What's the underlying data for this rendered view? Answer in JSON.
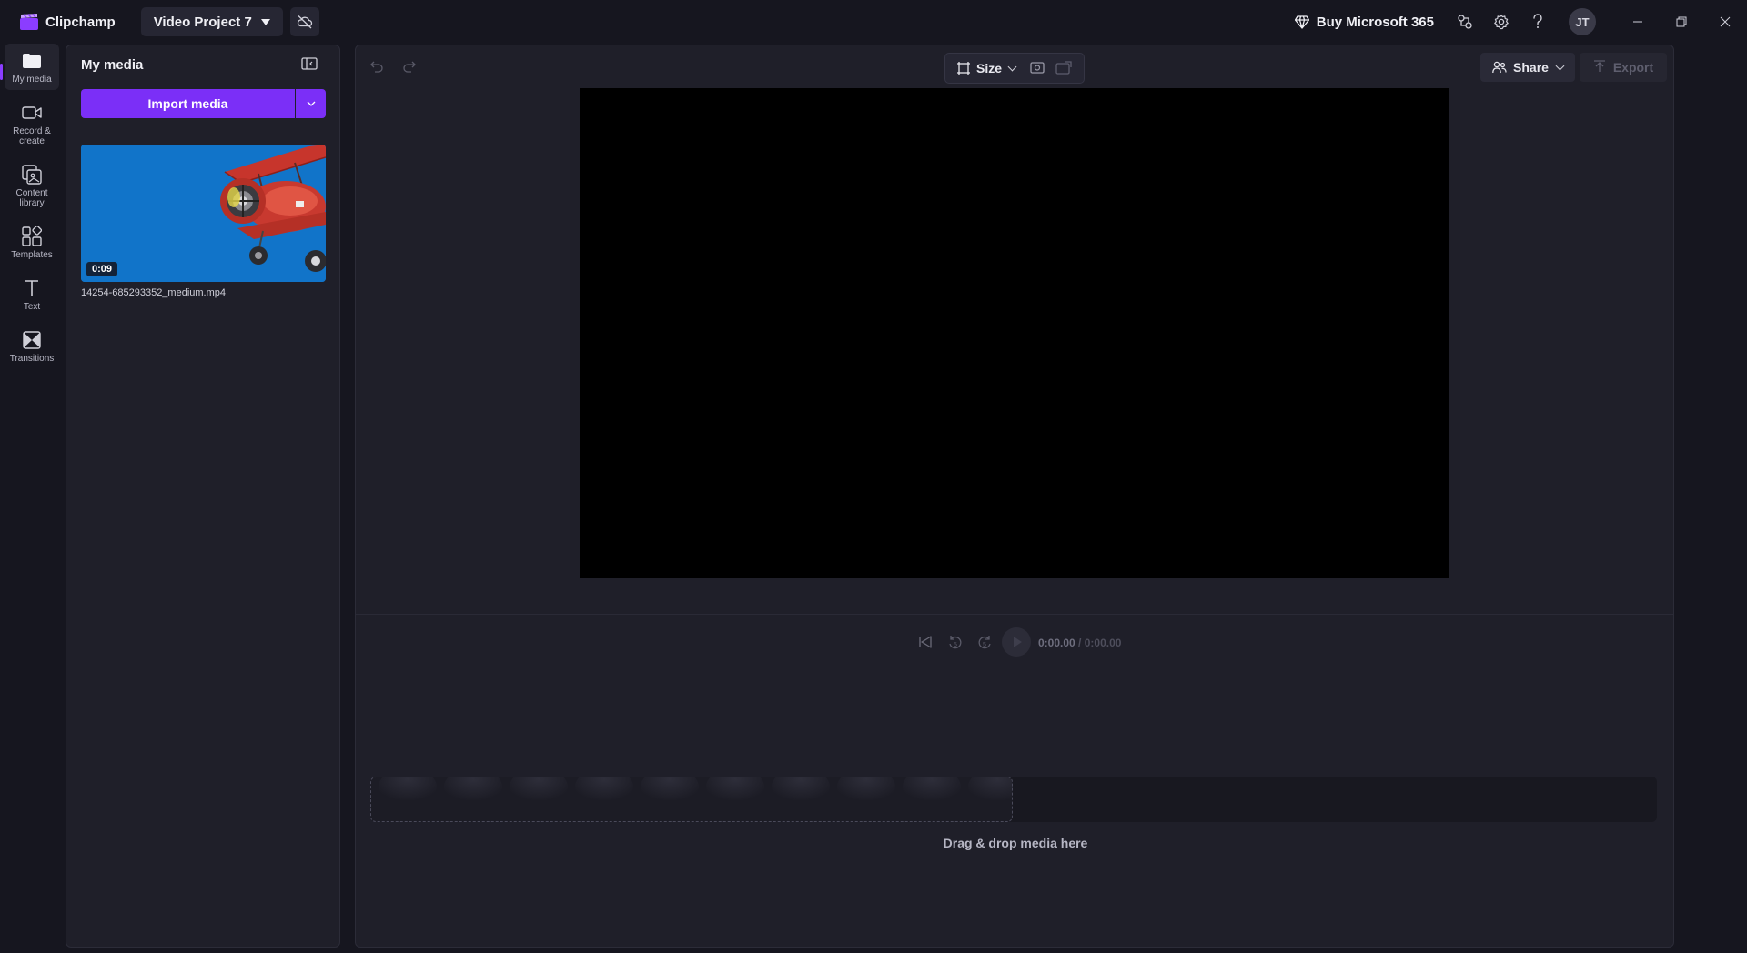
{
  "app": {
    "name": "Clipchamp",
    "brand_color": "#7b2ff7"
  },
  "project": {
    "name": "Video Project 7"
  },
  "topbar": {
    "buy_label": "Buy Microsoft 365",
    "avatar_initials": "JT",
    "icons": [
      "diamond-icon",
      "connections-icon",
      "settings-icon",
      "help-icon",
      "minimize-icon",
      "restore-icon",
      "close-icon"
    ]
  },
  "nav": {
    "items": [
      {
        "label": "My media",
        "icon": "folder-icon",
        "active": true
      },
      {
        "label": "Record & create",
        "icon": "camera-icon",
        "active": false
      },
      {
        "label": "Content library",
        "icon": "library-icon",
        "active": false
      },
      {
        "label": "Templates",
        "icon": "templates-icon",
        "active": false
      },
      {
        "label": "Text",
        "icon": "text-icon",
        "active": false
      },
      {
        "label": "Transitions",
        "icon": "transitions-icon",
        "active": false
      }
    ]
  },
  "media": {
    "title": "My media",
    "import_label": "Import media",
    "items": [
      {
        "duration": "0:09",
        "filename": "14254-685293352_medium.mp4"
      }
    ]
  },
  "editor": {
    "size_label": "Size",
    "share_label": "Share",
    "export_label": "Export",
    "time_current": "0:00.00",
    "time_separator": " / ",
    "time_total": "0:00.00",
    "skip_back_label": "5",
    "skip_forward_label": "5",
    "drop_text": "Drag & drop media here"
  }
}
